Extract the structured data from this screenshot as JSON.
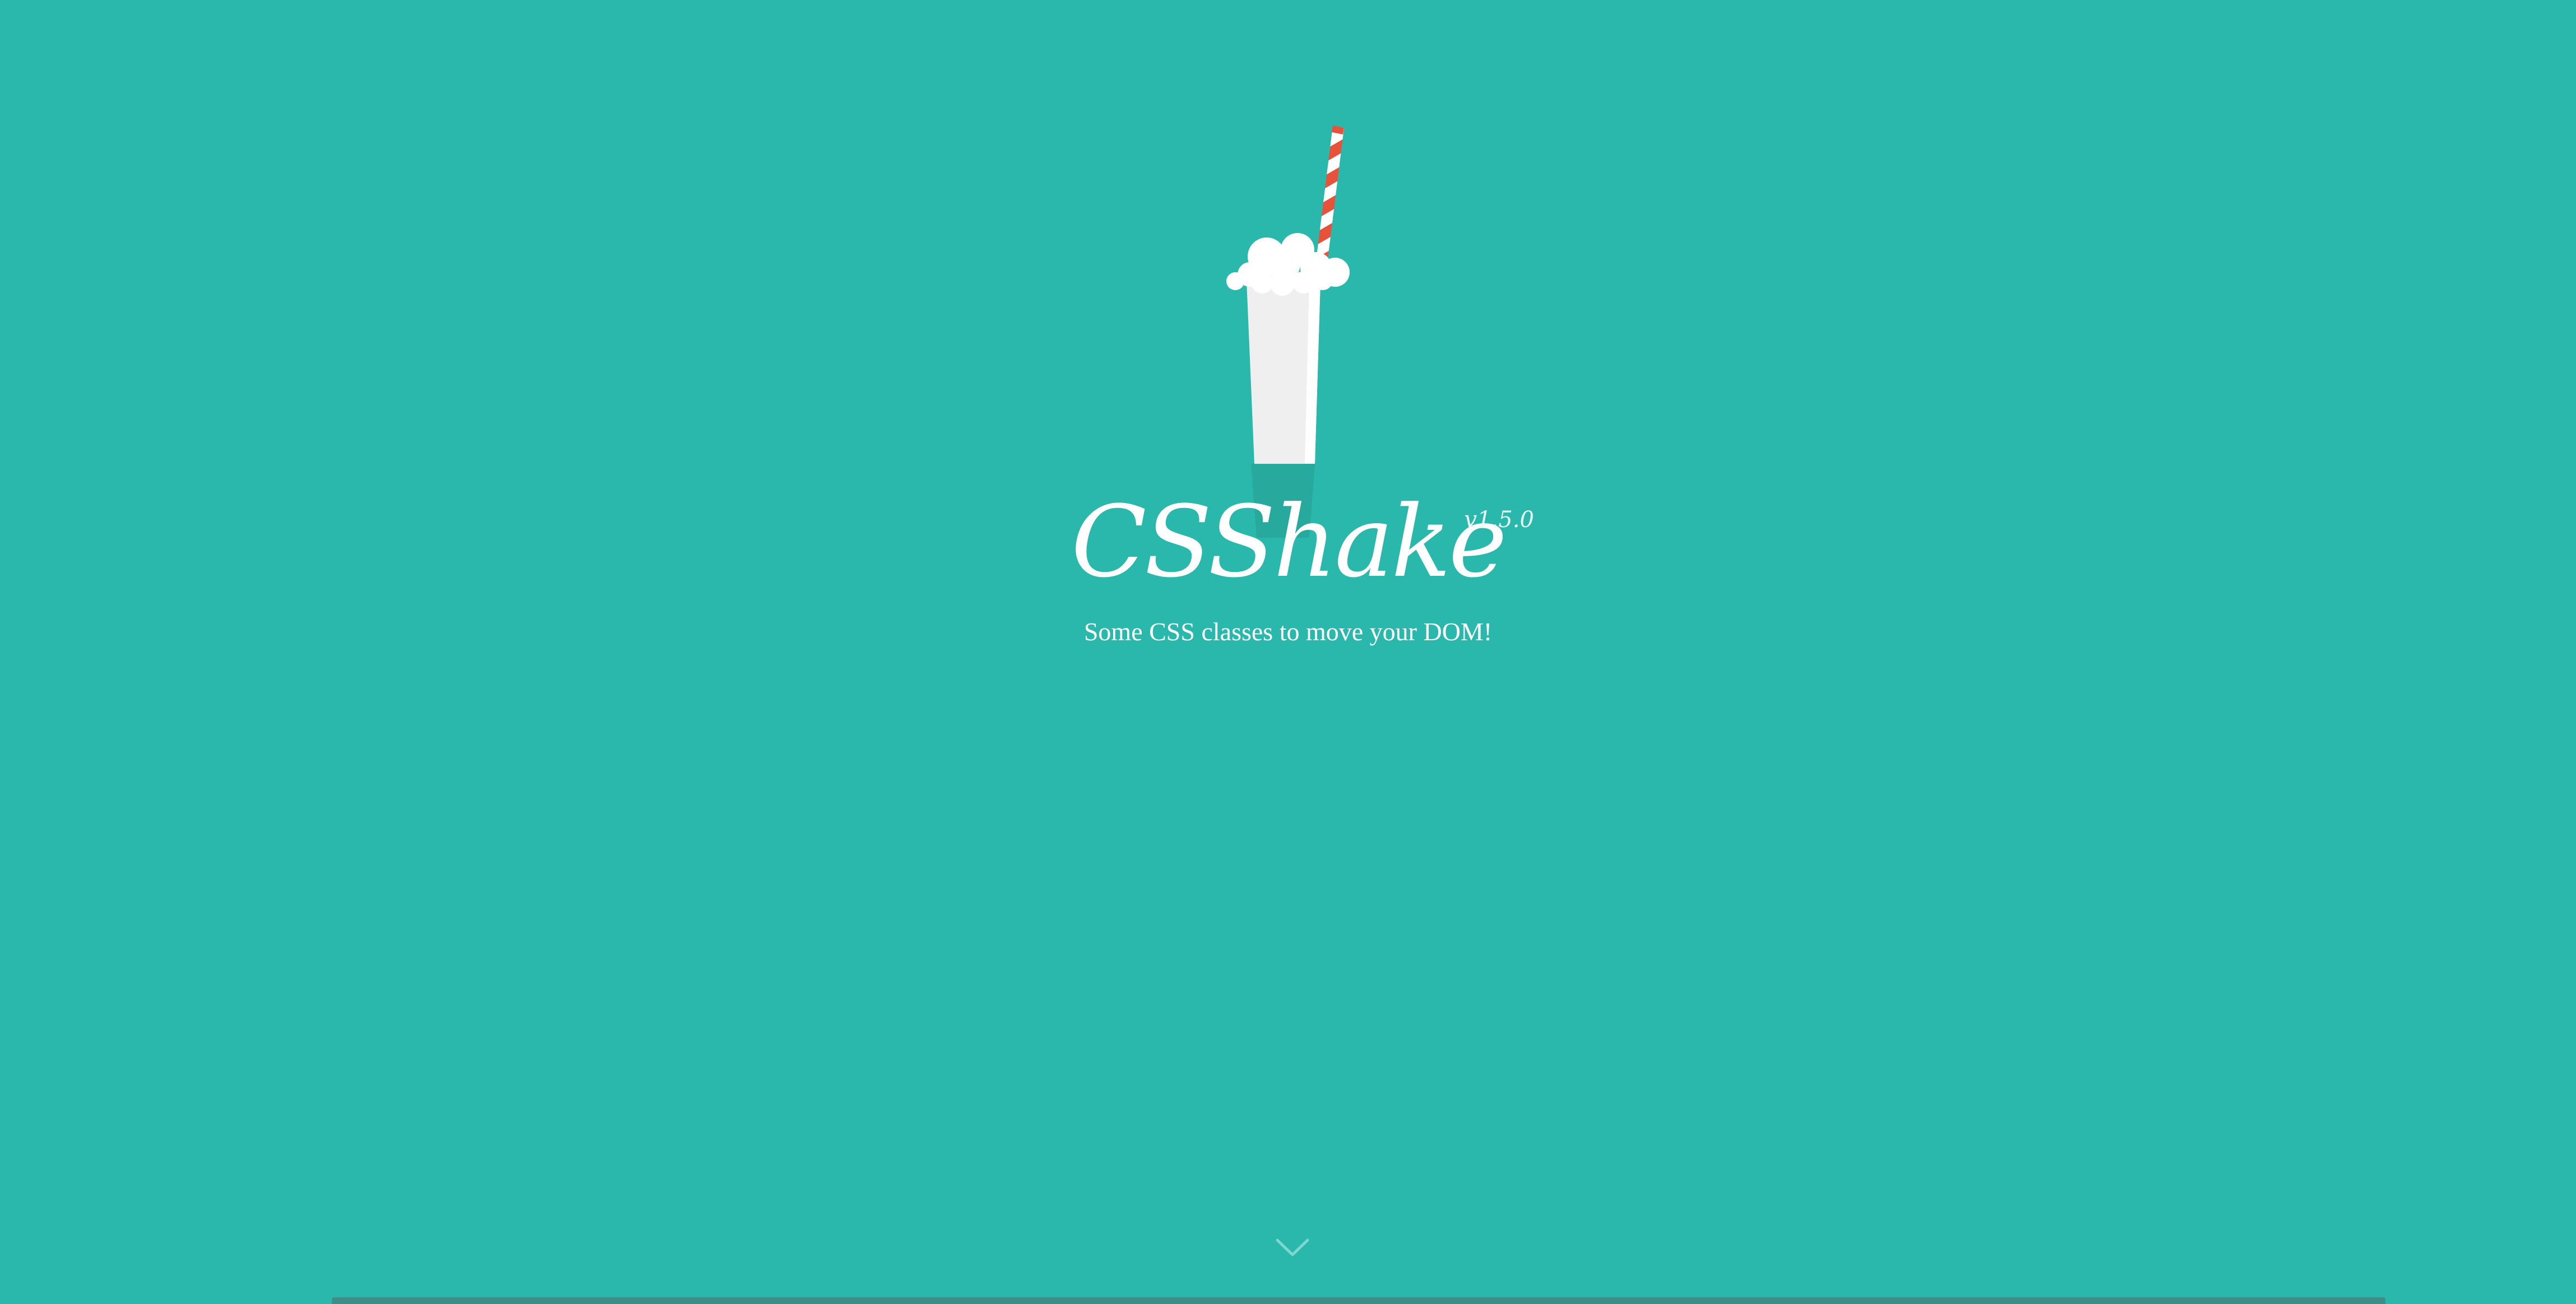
{
  "hero": {
    "title": "CSShake",
    "version": "v1.5.0",
    "tagline": "Some CSS classes to move your DOM!"
  },
  "logo": {
    "icon": "milkshake-icon",
    "straw_colors": [
      "#e8523a",
      "#ffffff"
    ],
    "cup_color": "#f0f0f0",
    "foam_color": "#ffffff"
  },
  "scroll": {
    "icon": "chevron-down-icon"
  },
  "colors": {
    "background": "#2bb8ac",
    "text": "#ffffff",
    "bottom_bar": "#3b8f88"
  }
}
